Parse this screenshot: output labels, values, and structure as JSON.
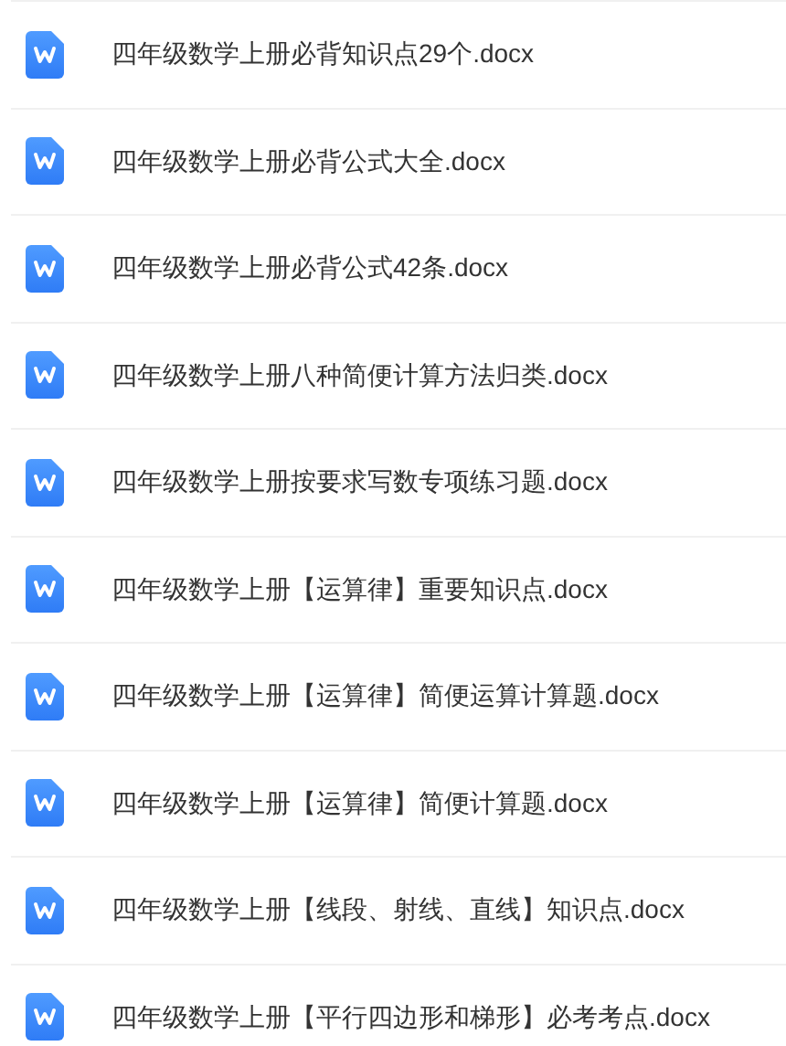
{
  "files": [
    {
      "name": "四年级数学上册必背知识点29个.docx"
    },
    {
      "name": "四年级数学上册必背公式大全.docx"
    },
    {
      "name": "四年级数学上册必背公式42条.docx"
    },
    {
      "name": "四年级数学上册八种简便计算方法归类.docx"
    },
    {
      "name": "四年级数学上册按要求写数专项练习题.docx"
    },
    {
      "name": "四年级数学上册【运算律】重要知识点.docx"
    },
    {
      "name": "四年级数学上册【运算律】简便运算计算题.docx"
    },
    {
      "name": "四年级数学上册【运算律】简便计算题.docx"
    },
    {
      "name": "四年级数学上册【线段、射线、直线】知识点.docx"
    },
    {
      "name": "四年级数学上册【平行四边形和梯形】必考考点.docx"
    }
  ]
}
